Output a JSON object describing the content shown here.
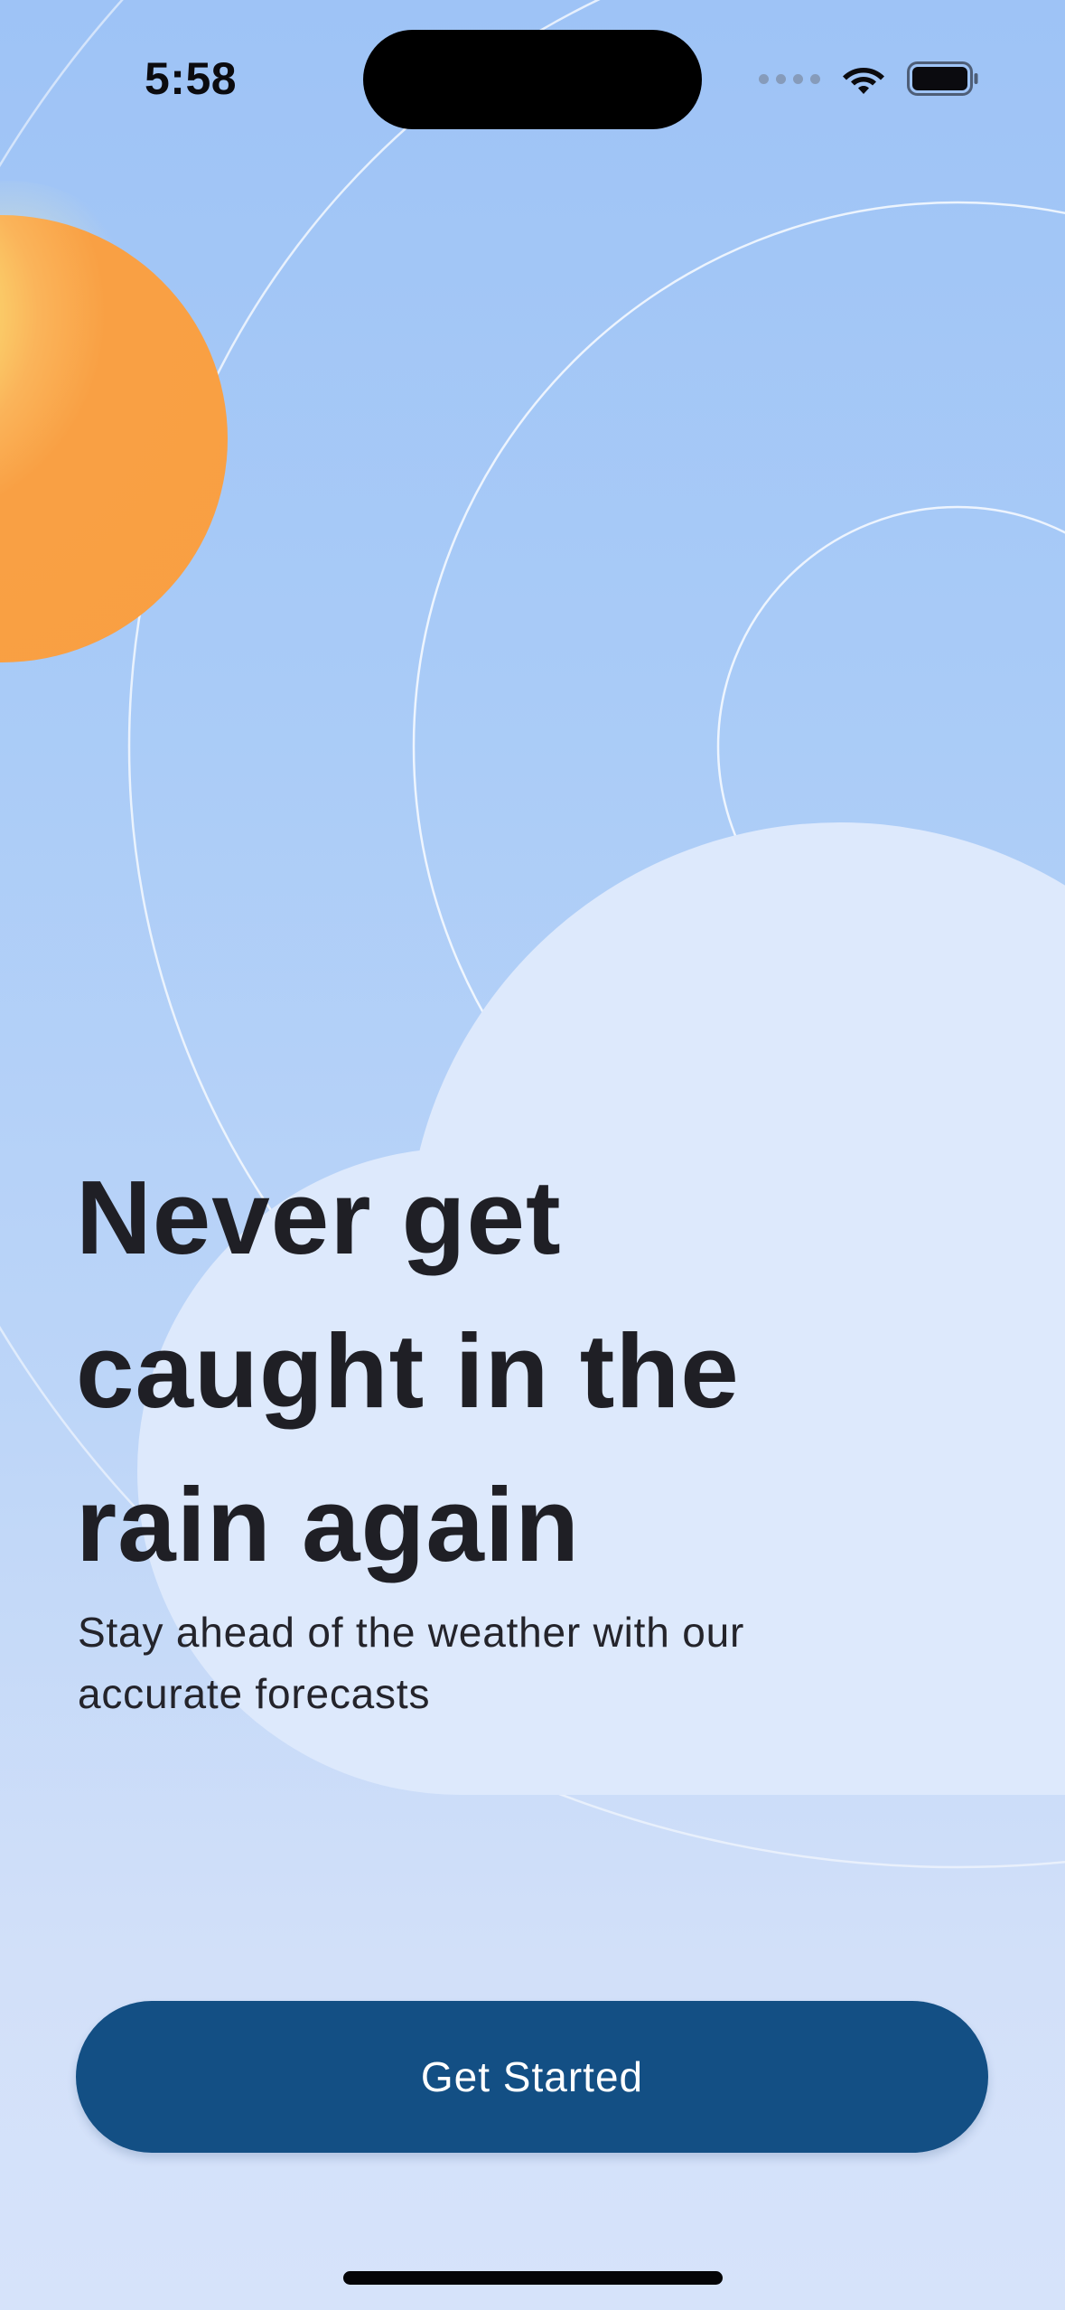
{
  "status_bar": {
    "time": "5:58",
    "icons": [
      "cellular-dots-icon",
      "wifi-icon",
      "battery-icon"
    ]
  },
  "illustration": {
    "sun_color": "#f99f42",
    "sun_highlight_color": "#fae57a",
    "cloud_color": "#dce8fb",
    "ring_color": "#ffffff"
  },
  "hero": {
    "headline_lines": [
      "Never get",
      "caught in the",
      "rain again"
    ],
    "subtitle_lines": [
      "Stay ahead of the weather with our",
      "accurate forecasts"
    ]
  },
  "cta": {
    "label": "Get Started",
    "color": "#134f84"
  }
}
